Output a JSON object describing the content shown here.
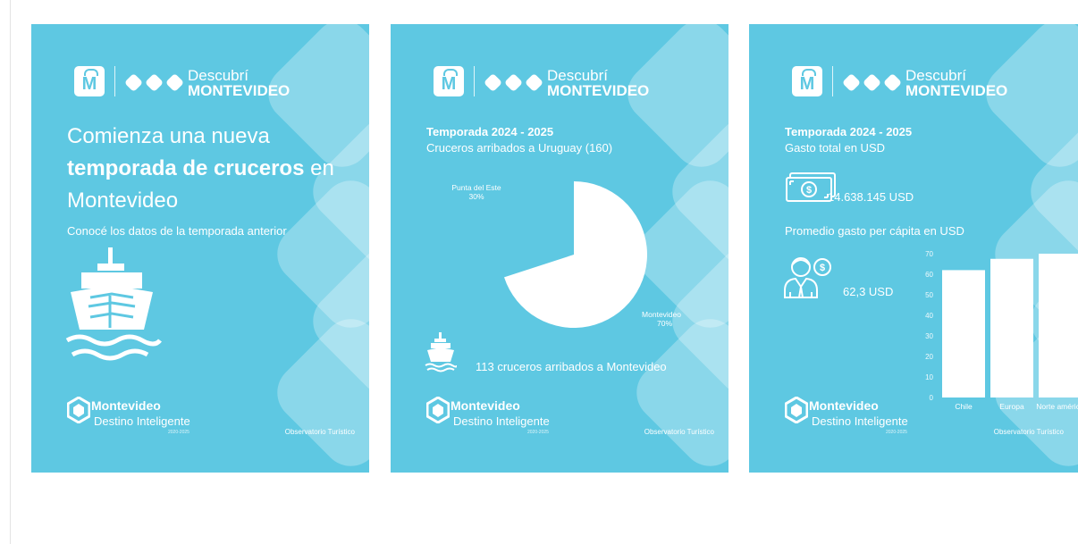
{
  "brand": {
    "line1": "Descubrí",
    "line2": "MONTEVIDEO",
    "icon_letter": "M"
  },
  "footer": {
    "name": "Montevideo",
    "sub": "Destino Inteligente",
    "years": "2020-2025",
    "observatory": "Observatorio Turístico"
  },
  "card1": {
    "headline_part1": "Comienza una nueva ",
    "headline_bold": "temporada de cruceros",
    "headline_part2": " en Montevideo",
    "subtitle": "Conocé los datos de la temporada anterior",
    "icon": "cruise-ship-icon"
  },
  "card2": {
    "season": "Temporada 2024 - 2025",
    "subtitle": "Cruceros arribados a Uruguay (160)",
    "summary": "113 cruceros arribados a Montevideo",
    "icon": "cruise-ship-icon"
  },
  "card3": {
    "season": "Temporada 2024 - 2025",
    "subtitle": "Gasto total en USD",
    "total": "14.638.145 USD",
    "avg_label": "Promedio gasto per cápita en USD",
    "avg_value": "62,3 USD",
    "icons": [
      "money-bill-icon",
      "person-dollar-icon"
    ]
  },
  "colors": {
    "background": "#5ec8e2",
    "foreground": "#ffffff"
  },
  "chart_data": [
    {
      "type": "pie",
      "labels": [
        "Montevideo",
        "Punta del Este"
      ],
      "values": [
        70,
        30
      ],
      "value_labels": [
        "70%",
        "30%"
      ]
    },
    {
      "type": "bar",
      "categories": [
        "Chile",
        "Europa",
        "Norte américa"
      ],
      "values": [
        62,
        67.5,
        70
      ],
      "ylim": [
        0,
        70
      ],
      "yticks": [
        0,
        10,
        20,
        30,
        40,
        50,
        60,
        70
      ]
    }
  ]
}
